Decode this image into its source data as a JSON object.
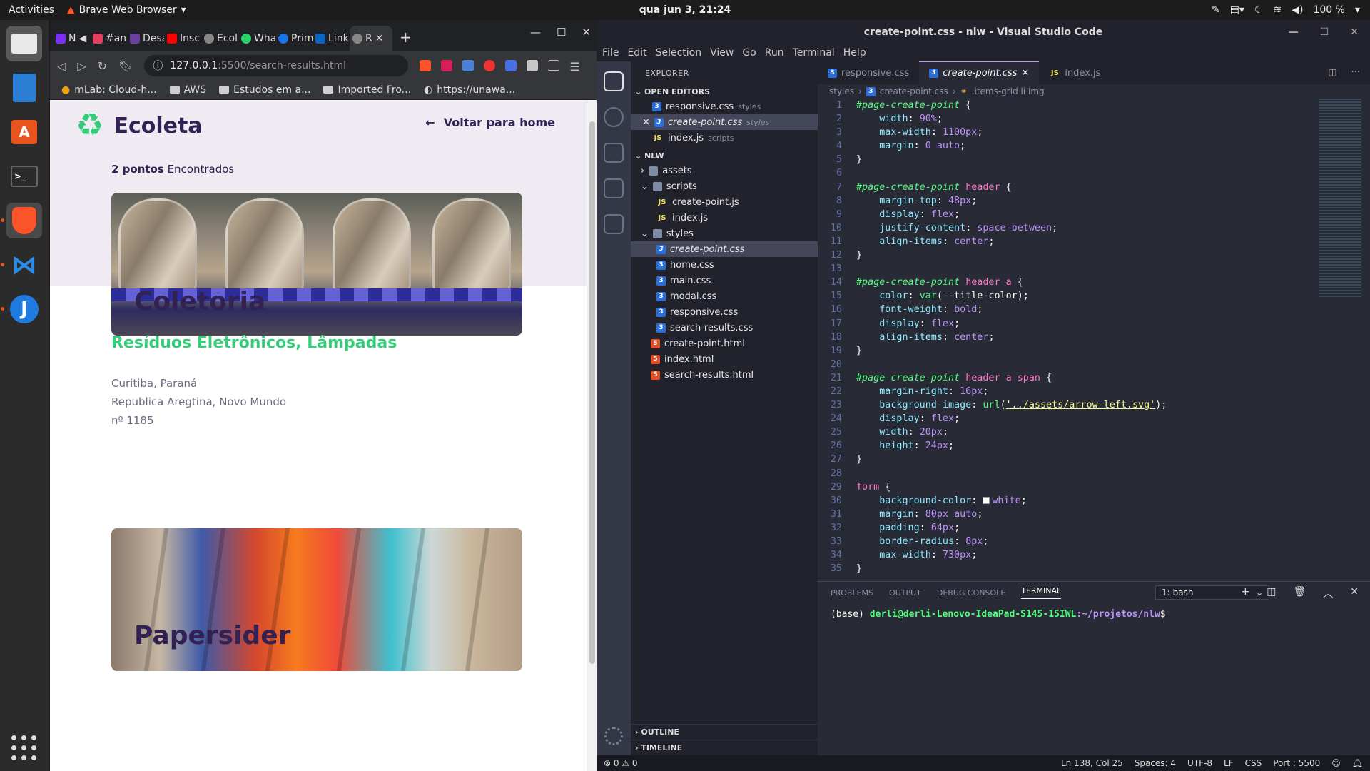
{
  "topbar": {
    "activities": "Activities",
    "app_name": "Brave Web Browser",
    "clock": "qua jun  3, 21:24",
    "battery": "100 %"
  },
  "dock": {
    "items": [
      "files",
      "writer",
      "software",
      "terminal",
      "brave",
      "vscode",
      "jdownloader"
    ]
  },
  "browser": {
    "tabs": [
      {
        "label": "N",
        "color": "#7b2ff7"
      },
      {
        "label": "#anc",
        "color": "#e4405f"
      },
      {
        "label": "Desa",
        "color": "#6b3fa0"
      },
      {
        "label": "Inscr",
        "color": "#ff0000"
      },
      {
        "label": "Ecol",
        "color": "#888888"
      },
      {
        "label": "Wha",
        "color": "#25d366"
      },
      {
        "label": "Prim",
        "color": "#1a73e8"
      },
      {
        "label": "Link",
        "color": "#0a66c2"
      },
      {
        "label": "R",
        "color": "#888888"
      }
    ],
    "url_host": "127.0.0.1",
    "url_rest": ":5500/search-results.html",
    "bookmarks": [
      "mLab: Cloud-h...",
      "AWS",
      "Estudos em a...",
      "Imported Fro...",
      "https://unawa..."
    ]
  },
  "page": {
    "logo": "Ecoleta",
    "back_link": "Voltar para home",
    "count_strong": "2 pontos",
    "count_rest": " Encontrados",
    "cards": [
      {
        "title": "Coletoria",
        "items": "Resíduos Eletrônicos, Lâmpadas",
        "addr1": "Curitiba, Paraná",
        "addr2": "Republica Aregtina, Novo Mundo",
        "addr3": "nº 1185"
      },
      {
        "title": "Papersider"
      }
    ]
  },
  "vscode": {
    "title": "create-point.css - nlw - Visual Studio Code",
    "menu": [
      "File",
      "Edit",
      "Selection",
      "View",
      "Go",
      "Run",
      "Terminal",
      "Help"
    ],
    "explorer": {
      "header": "EXPLORER",
      "open_editors_label": "OPEN EDITORS",
      "open_editors": [
        {
          "name": "responsive.css",
          "dir": "styles",
          "type": "css"
        },
        {
          "name": "create-point.css",
          "dir": "styles",
          "type": "css"
        },
        {
          "name": "index.js",
          "dir": "scripts",
          "type": "js"
        }
      ],
      "root": "NLW",
      "tree": [
        {
          "name": "assets",
          "type": "folder",
          "depth": 1
        },
        {
          "name": "scripts",
          "type": "folder",
          "depth": 1
        },
        {
          "name": "create-point.js",
          "type": "js",
          "depth": 2
        },
        {
          "name": "index.js",
          "type": "js",
          "depth": 2
        },
        {
          "name": "styles",
          "type": "folder",
          "depth": 1
        },
        {
          "name": "create-point.css",
          "type": "css",
          "depth": 2
        },
        {
          "name": "home.css",
          "type": "css",
          "depth": 2
        },
        {
          "name": "main.css",
          "type": "css",
          "depth": 2
        },
        {
          "name": "modal.css",
          "type": "css",
          "depth": 2
        },
        {
          "name": "responsive.css",
          "type": "css",
          "depth": 2
        },
        {
          "name": "search-results.css",
          "type": "css",
          "depth": 2
        },
        {
          "name": "create-point.html",
          "type": "html",
          "depth": 1
        },
        {
          "name": "index.html",
          "type": "html",
          "depth": 1
        },
        {
          "name": "search-results.html",
          "type": "html",
          "depth": 1
        }
      ],
      "outline": "OUTLINE",
      "timeline": "TIMELINE"
    },
    "tabs": [
      {
        "name": "responsive.css",
        "type": "css",
        "active": false
      },
      {
        "name": "create-point.css",
        "type": "css",
        "active": true
      },
      {
        "name": "index.js",
        "type": "js",
        "active": false
      }
    ],
    "breadcrumb": [
      "styles",
      "create-point.css",
      ".items-grid li img"
    ],
    "panel_tabs": [
      "PROBLEMS",
      "OUTPUT",
      "DEBUG CONSOLE",
      "TERMINAL"
    ],
    "terminal_select": "1: bash",
    "terminal": {
      "prefix": "(base) ",
      "user": "derli@derli-Lenovo-IdeaPad-S145-15IWL",
      "path": ":~/projetos/nlw",
      "prompt": "$"
    },
    "status": {
      "left": "⊗ 0 ⚠ 0",
      "position": "Ln 138, Col 25",
      "spaces": "Spaces: 4",
      "encoding": "UTF-8",
      "eol": "LF",
      "lang": "CSS",
      "port": "Port : 5500"
    }
  }
}
